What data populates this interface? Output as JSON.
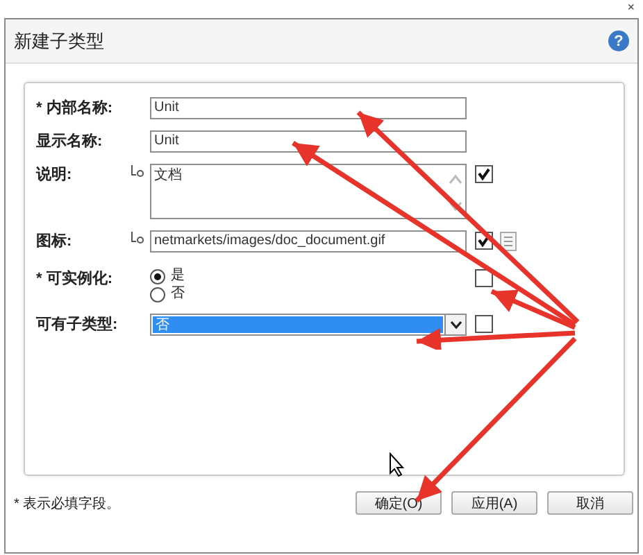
{
  "window": {
    "title": "新建子类型",
    "help": "?",
    "close": "×"
  },
  "fields": [
    {
      "kind": "text",
      "label": "* 内部名称:",
      "value": "Unit"
    },
    {
      "kind": "text",
      "label": "显示名称:",
      "value": "Unit"
    },
    {
      "kind": "textarea",
      "label": "说明:",
      "localized": true,
      "value": "文档",
      "checked": true
    },
    {
      "kind": "text",
      "label": "图标:",
      "localized": true,
      "value": "netmarkets/images/doc_document.gif",
      "checked": true,
      "browse": true
    },
    {
      "kind": "radio",
      "label": "* 可实例化:",
      "options": [
        {
          "label": "是",
          "selected": true
        },
        {
          "label": "否",
          "selected": false
        }
      ],
      "checked": false
    },
    {
      "kind": "select",
      "label": "可有子类型:",
      "value": "否",
      "checked": false
    }
  ],
  "footer": {
    "note": "* 表示必填字段。"
  },
  "buttons": [
    "确定(O)",
    "应用(A)",
    "取消"
  ]
}
